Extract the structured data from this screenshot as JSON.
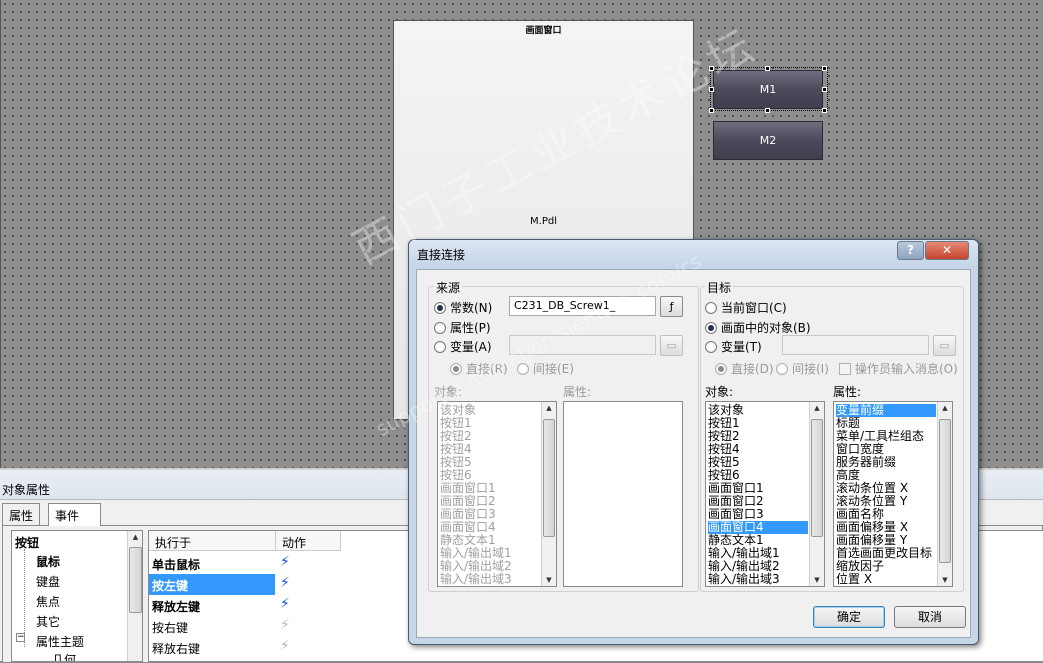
{
  "canvas": {
    "picture_window": {
      "title": "画面窗口",
      "file": "M.Pdl"
    },
    "buttons": [
      {
        "label": "M1"
      },
      {
        "label": "M2"
      }
    ]
  },
  "properties_panel": {
    "title": "对象属性",
    "tabs": [
      {
        "label": "属性"
      },
      {
        "label": "事件"
      }
    ],
    "tree": {
      "root": "按钮",
      "items": [
        "鼠标",
        "键盘",
        "焦点",
        "其它"
      ],
      "theme": "属性主题",
      "theme_child": "几何"
    },
    "table": {
      "headers": [
        "执行于",
        "动作"
      ],
      "rows": [
        "单击鼠标",
        "按左键",
        "释放左键",
        "按右键",
        "释放右键"
      ]
    }
  },
  "dialog": {
    "title": "直接连接",
    "help": "?",
    "close": "✕",
    "source": {
      "label": "来源",
      "constant": "常数(N)",
      "constant_value": "C231_DB_Screw1_",
      "property": "属性(P)",
      "variable": "变量(A)",
      "direct": "直接(R)",
      "indirect": "间接(E)",
      "object_label": "对象:",
      "attribute_label": "属性:",
      "objects": [
        "该对象",
        "按钮1",
        "按钮2",
        "按钮4",
        "按钮5",
        "按钮6",
        "画面窗口1",
        "画面窗口2",
        "画面窗口3",
        "画面窗口4",
        "静态文本1",
        "输入/输出域1",
        "输入/输出域2",
        "输入/输出域3"
      ]
    },
    "target": {
      "label": "目标",
      "current_window": "当前窗口(C)",
      "object_in_picture": "画面中的对象(B)",
      "variable": "变量(T)",
      "direct": "直接(D)",
      "indirect": "间接(I)",
      "operator_msg": "操作员输入消息(O)",
      "object_label": "对象:",
      "attribute_label": "属性:",
      "objects": [
        "该对象",
        "按钮1",
        "按钮2",
        "按钮4",
        "按钮5",
        "按钮6",
        "画面窗口1",
        "画面窗口2",
        "画面窗口3",
        "画面窗口4",
        "静态文本1",
        "输入/输出域1",
        "输入/输出域2",
        "输入/输出域3"
      ],
      "selected_object": "画面窗口4",
      "attributes": [
        "变量前缀",
        "标题",
        "菜单/工具栏组态",
        "窗口宽度",
        "服务器前缀",
        "高度",
        "滚动条位置 X",
        "滚动条位置 Y",
        "画面名称",
        "画面偏移量 X",
        "画面偏移量 Y",
        "首选画面更改目标",
        "缩放因子",
        "位置 X"
      ],
      "selected_attribute": "变量前缀"
    },
    "ok": "确定",
    "cancel": "取消"
  },
  "watermark": {
    "text": "西门子工业技术论坛",
    "url": "support.automation.siemens.com/cs"
  },
  "colors": {
    "selection": "#3399ff",
    "hmi_button": "#4a4a5a",
    "canvas": "#8e8e8e"
  }
}
